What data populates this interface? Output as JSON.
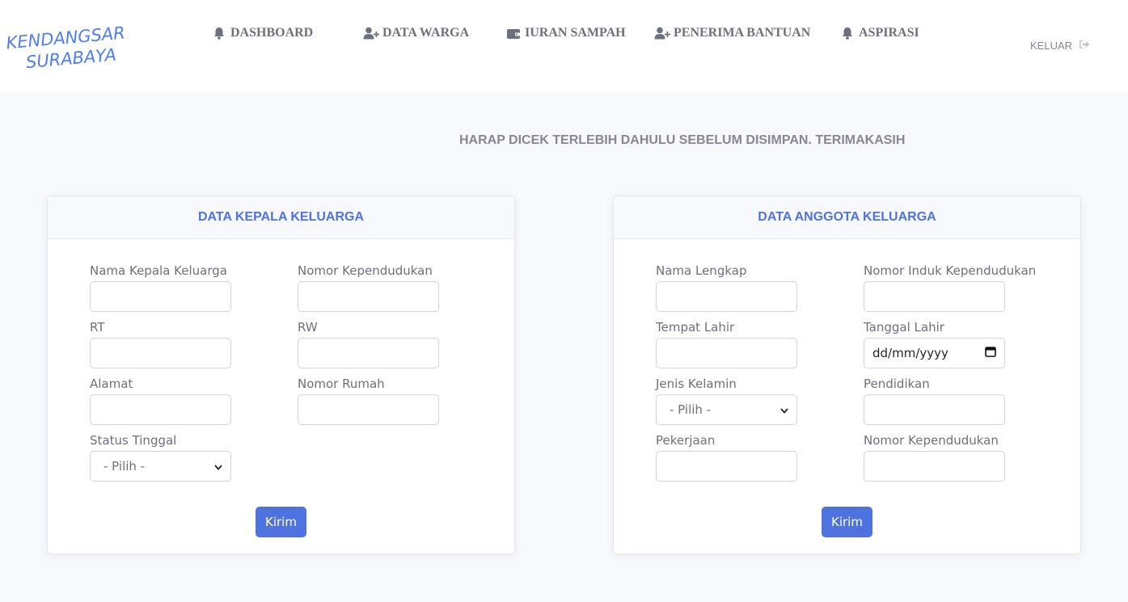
{
  "brand": {
    "line1": "KENDANGSARI",
    "line2": "SURABAYA",
    "logo_color": "#4e7df5"
  },
  "nav": {
    "items": [
      {
        "label": "DASHBOARD",
        "icon": "bell-icon"
      },
      {
        "label": "DATA WARGA",
        "icon": "user-plus-icon"
      },
      {
        "label": "IURAN SAMPAH",
        "icon": "wallet-icon"
      },
      {
        "label": "PENERIMA BANTUAN",
        "icon": "user-plus-icon"
      },
      {
        "label": "ASPIRASI",
        "icon": "bell-icon"
      }
    ],
    "logout_label": "KELUAR",
    "logout_icon": "sign-out-icon"
  },
  "notice": "HARAP DICEK TERLEBIH DAHULU SEBELUM DISIMPAN. TERIMAKASIH",
  "kepala": {
    "title": "DATA KEPALA KELUARGA",
    "fields": {
      "nama": {
        "label": "Nama Kepala Keluarga",
        "value": ""
      },
      "nomor_kependudukan": {
        "label": "Nomor Kependudukan",
        "value": ""
      },
      "rt": {
        "label": "RT",
        "value": ""
      },
      "rw": {
        "label": "RW",
        "value": ""
      },
      "alamat": {
        "label": "Alamat",
        "value": ""
      },
      "nomor_rumah": {
        "label": "Nomor Rumah",
        "value": ""
      },
      "status_tinggal": {
        "label": "Status Tinggal",
        "selected": "- Pilih -"
      }
    },
    "submit_label": "Kirim"
  },
  "anggota": {
    "title": "DATA ANGGOTA KELUARGA",
    "fields": {
      "nama_lengkap": {
        "label": "Nama Lengkap",
        "value": ""
      },
      "nik": {
        "label": "Nomor Induk Kependudukan",
        "value": ""
      },
      "tempat_lahir": {
        "label": "Tempat Lahir",
        "value": ""
      },
      "tanggal_lahir": {
        "label": "Tanggal Lahir",
        "placeholder": "dd/mm/yyyy"
      },
      "jenis_kelamin": {
        "label": "Jenis Kelamin",
        "selected": "- Pilih -"
      },
      "pendidikan": {
        "label": "Pendidikan",
        "value": ""
      },
      "pekerjaan": {
        "label": "Pekerjaan",
        "value": ""
      },
      "nomor_kependudukan": {
        "label": "Nomor Kependudukan",
        "value": ""
      }
    },
    "submit_label": "Kirim"
  },
  "colors": {
    "primary": "#4e73df",
    "background": "#f8f9fc",
    "text": "#858796",
    "nav_text": "#6e707e"
  }
}
